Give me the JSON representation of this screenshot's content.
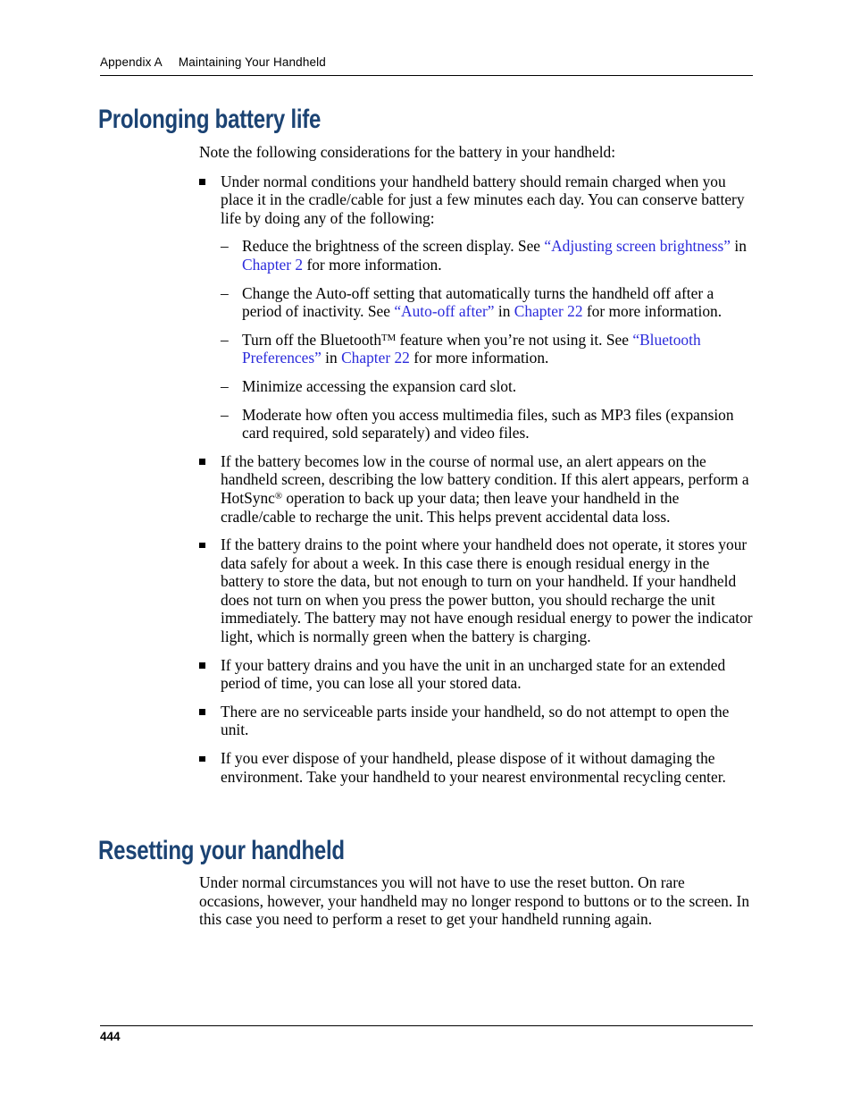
{
  "header": {
    "appendix_label": "Appendix A",
    "chapter_title": "Maintaining Your Handheld"
  },
  "footer": {
    "page_number": "444"
  },
  "colors": {
    "heading": "#1b4373",
    "cross_reference_link": "#2b2bdb",
    "body_text": "#000000",
    "rule": "#000000",
    "page_background": "#ffffff"
  },
  "sections": [
    {
      "id": "prolonging-battery-life",
      "heading": "Prolonging battery life",
      "intro": "Note the following considerations for the battery in your handheld:",
      "bullets": [
        {
          "text": "Under normal conditions your handheld battery should remain charged when you place it in the cradle/cable for just a few minutes each day. You can conserve battery life by doing any of the following:",
          "sub_bullets": [
            {
              "prefix": "Reduce the brightness of the screen display. See ",
              "link1": "“Adjusting screen brightness”",
              "mid": " in ",
              "link2": "Chapter 2",
              "suffix": " for more information."
            },
            {
              "prefix": "Change the Auto-off setting that automatically turns the handheld off after a period of inactivity. See ",
              "link1": "“Auto-off after”",
              "mid": " in ",
              "link2": "Chapter 22",
              "suffix": " for more information."
            },
            {
              "prefix_a": "Turn off the Bluetooth",
              "trademark": "TM",
              "prefix_b": " feature when you’re not using it. See ",
              "link1": "“Bluetooth Preferences”",
              "mid": " in ",
              "link2": "Chapter 22",
              "suffix": " for more information."
            },
            {
              "plain": "Minimize accessing the expansion card slot."
            },
            {
              "plain": "Moderate how often you access multimedia files, such as MP3 files (expansion card required, sold separately) and video files."
            }
          ]
        },
        {
          "part_a": "If the battery becomes low in the course of normal use, an alert appears on the handheld screen, describing the low battery condition. If this alert appears, perform a HotSync",
          "registered": "®",
          "part_b": " operation to back up your data; then leave your handheld in the cradle/cable to recharge the unit. This helps prevent accidental data loss."
        },
        {
          "text": "If the battery drains to the point where your handheld does not operate, it stores your data safely for about a week. In this case there is enough residual energy in the battery to store the data, but not enough to turn on your handheld. If your handheld does not turn on when you press the power button, you should recharge the unit immediately. The battery may not have enough residual energy to power the indicator light, which is normally green when the battery is charging."
        },
        {
          "text": "If your battery drains and you have the unit in an uncharged state for an extended period of time, you can lose all your stored data."
        },
        {
          "text": "There are no serviceable parts inside your handheld, so do not attempt to open the unit."
        },
        {
          "text": "If you ever dispose of your handheld, please dispose of it without damaging the environment. Take your handheld to your nearest environmental recycling center."
        }
      ]
    },
    {
      "id": "resetting-your-handheld",
      "heading": "Resetting your handheld",
      "paragraph": "Under normal circumstances you will not have to use the reset button. On rare occasions, however, your handheld may no longer respond to buttons or to the screen. In this case you need to perform a reset to get your handheld running again."
    }
  ],
  "icons": {
    "square_bullet": "square-bullet-icon",
    "dash_bullet": "en-dash-bullet-icon"
  },
  "glyphs": {
    "dash": "–"
  }
}
